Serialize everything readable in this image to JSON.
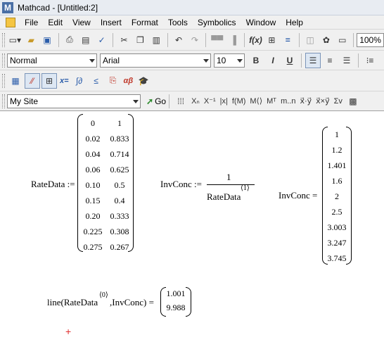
{
  "window": {
    "title": "Mathcad - [Untitled:2]",
    "app_icon": "M"
  },
  "menu": [
    "File",
    "Edit",
    "View",
    "Insert",
    "Format",
    "Tools",
    "Symbolics",
    "Window",
    "Help"
  ],
  "standard_toolbar": {
    "zoom": "100%"
  },
  "formatting_toolbar": {
    "style": "Normal",
    "font": "Arial",
    "size": "10",
    "bold": "B",
    "italic": "I",
    "underline": "U"
  },
  "math_toolbar": {
    "eval_label": "x=",
    "greek_label": "αβ"
  },
  "resource_toolbar": {
    "site": "My Site",
    "go_label": "Go",
    "labels": {
      "subscript": "Xₙ",
      "inverse": "X⁻¹",
      "abs": "|x|",
      "vectorize": "f(M)",
      "column": "M⟨⟩",
      "transpose": "Mᵀ",
      "range": "m..n",
      "dot": "x⃗·y⃗",
      "cross": "x⃗×y⃗",
      "sum": "Σv"
    }
  },
  "worksheet": {
    "ratedata_label": "RateData :=",
    "ratedata": [
      [
        "0",
        "1"
      ],
      [
        "0.02",
        "0.833"
      ],
      [
        "0.04",
        "0.714"
      ],
      [
        "0.06",
        "0.625"
      ],
      [
        "0.10",
        "0.5"
      ],
      [
        "0.15",
        "0.4"
      ],
      [
        "0.20",
        "0.333"
      ],
      [
        "0.225",
        "0.308"
      ],
      [
        "0.275",
        "0.267"
      ]
    ],
    "invconc_def_label": "InvConc :=",
    "invconc_numerator": "1",
    "invconc_denominator": "RateData",
    "invconc_denominator_sup": "⟨1⟩",
    "invconc_result_label": "InvConc =",
    "invconc": [
      "1",
      "1.2",
      "1.401",
      "1.6",
      "2",
      "2.5",
      "3.003",
      "3.247",
      "3.745"
    ],
    "line_prefix": "line(RateData",
    "line_sup": "⟨0⟩",
    "line_suffix": ",InvConc) =",
    "line_result": [
      "1.001",
      "9.988"
    ]
  },
  "cursor_glyph": "+"
}
